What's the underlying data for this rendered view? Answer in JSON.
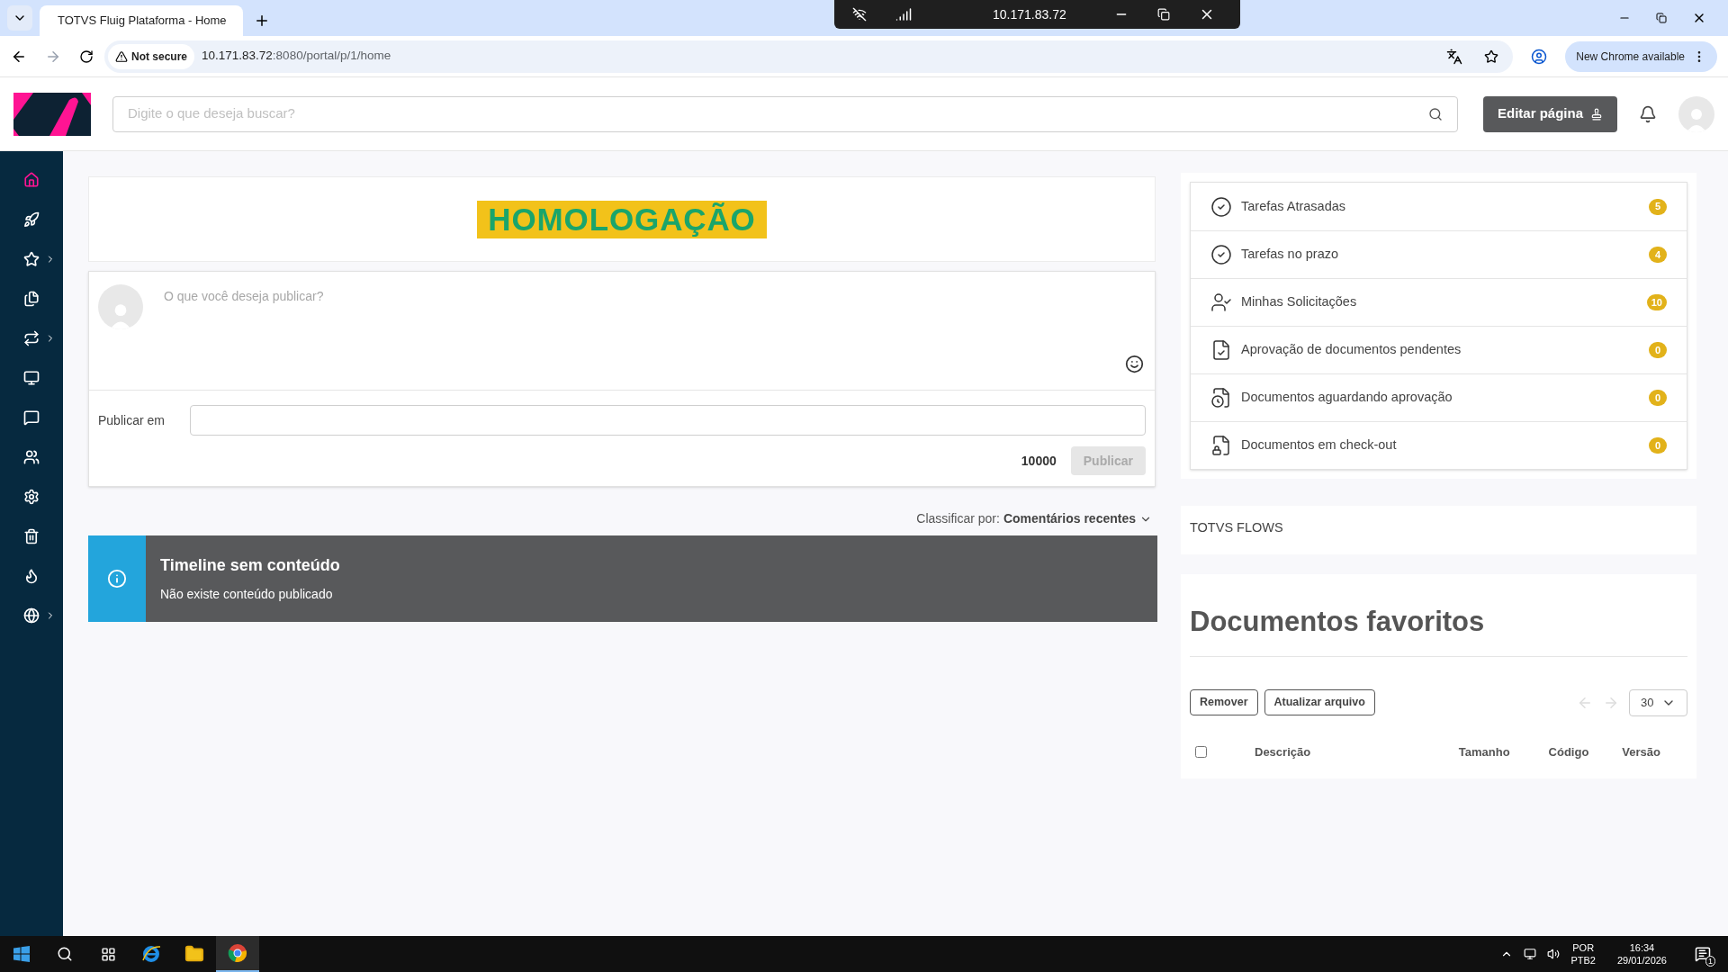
{
  "browser": {
    "tab_title": "TOTVS Fluig Plataforma - Home",
    "security": "Not secure",
    "url_host": "10.171.83.72",
    "url_path": ":8080/portal/p/1/home",
    "update_button": "New Chrome available"
  },
  "remote_toolbar": {
    "address": "10.171.83.72"
  },
  "header": {
    "search_placeholder": "Digite o que deseja buscar?",
    "edit_button": "Editar página"
  },
  "sidebar": {
    "items": [
      {
        "kind": "home",
        "selected": true,
        "has_submenu": false
      },
      {
        "kind": "rocket",
        "selected": false,
        "has_submenu": false
      },
      {
        "kind": "star",
        "selected": false,
        "has_submenu": true
      },
      {
        "kind": "documents",
        "selected": false,
        "has_submenu": false
      },
      {
        "kind": "arrows",
        "selected": false,
        "has_submenu": true
      },
      {
        "kind": "monitor",
        "selected": false,
        "has_submenu": false
      },
      {
        "kind": "chat",
        "selected": false,
        "has_submenu": false
      },
      {
        "kind": "people",
        "selected": false,
        "has_submenu": false
      },
      {
        "kind": "settings",
        "selected": false,
        "has_submenu": false
      },
      {
        "kind": "trash",
        "selected": false,
        "has_submenu": false
      },
      {
        "kind": "flame",
        "selected": false,
        "has_submenu": false
      },
      {
        "kind": "globe",
        "selected": false,
        "has_submenu": true
      }
    ]
  },
  "environment_badge": "HOMOLOGAÇÃO",
  "composer": {
    "placeholder": "O que você deseja publicar?",
    "publish_in_label": "Publicar em",
    "char_count": "10000",
    "publish_button": "Publicar",
    "publish_disabled": true
  },
  "timeline": {
    "sort_label": "Classificar por:",
    "sort_value": "Comentários recentes",
    "alert_title": "Timeline sem conteúdo",
    "alert_message": "Não existe conteúdo publicado"
  },
  "tasks": [
    {
      "kind": "task",
      "label": "Tarefas Atrasadas",
      "count": "5"
    },
    {
      "kind": "task",
      "label": "Tarefas no prazo",
      "count": "4"
    },
    {
      "kind": "request",
      "label": "Minhas Solicitações",
      "count": "10"
    },
    {
      "kind": "approval",
      "label": "Aprovação de documentos pendentes",
      "count": "0"
    },
    {
      "kind": "waiting",
      "label": "Documentos aguardando aprovação",
      "count": "0"
    },
    {
      "kind": "checkout",
      "label": "Documentos em check-out",
      "count": "0"
    }
  ],
  "flows_image_alt": "TOTVS FLOWS",
  "favorites": {
    "title": "Documentos favoritos",
    "buttons": [
      "Remover",
      "Atualizar arquivo"
    ],
    "page_size": "30",
    "select_all_checked": false,
    "columns": [
      "Descrição",
      "Tamanho",
      "Código",
      "Versão"
    ]
  },
  "taskbar": {
    "language": "POR",
    "layout": "PTB2",
    "time": "16:34",
    "date": "29/01/2026",
    "notifications": "1"
  }
}
